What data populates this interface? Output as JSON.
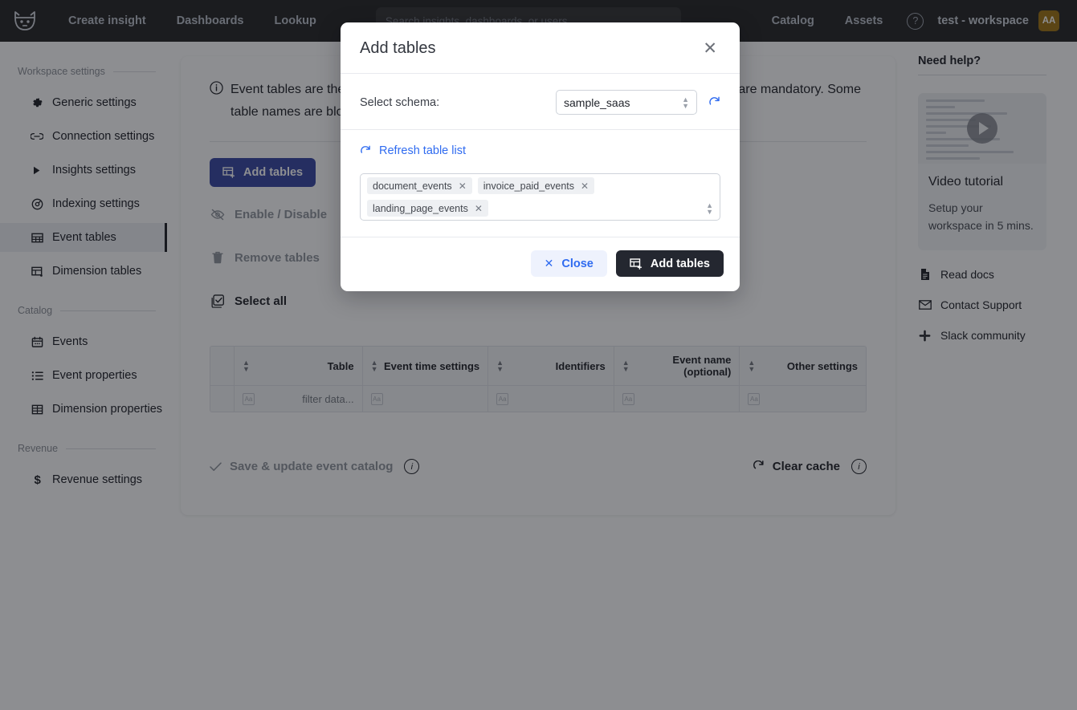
{
  "topnav": {
    "logo_icon": "cat-logo-icon",
    "links": [
      "Create insight",
      "Dashboards",
      "Lookup",
      "Catalog",
      "Assets"
    ],
    "search_placeholder": "Search insights, dashboards, or users",
    "search_value": "",
    "help_icon": "question-mark-icon",
    "workspace": "test - workspace",
    "avatar_initials": "AA"
  },
  "sidebar": {
    "groups": [
      {
        "title": "Workspace settings",
        "items": [
          {
            "label": "Generic settings",
            "icon": "gear-icon",
            "active": false
          },
          {
            "label": "Connection settings",
            "icon": "link-icon",
            "active": false
          },
          {
            "label": "Insights settings",
            "icon": "triangle-right-icon",
            "active": false
          },
          {
            "label": "Indexing settings",
            "icon": "compass-icon",
            "active": false
          },
          {
            "label": "Event tables",
            "icon": "table-icon",
            "active": true
          },
          {
            "label": "Dimension tables",
            "icon": "dimension-table-icon",
            "active": false
          }
        ]
      },
      {
        "title": "Catalog",
        "items": [
          {
            "label": "Events",
            "icon": "calendar-icon",
            "active": false
          },
          {
            "label": "Event properties",
            "icon": "list-icon",
            "active": false
          },
          {
            "label": "Dimension properties",
            "icon": "grid-icon",
            "active": false
          }
        ]
      },
      {
        "title": "Revenue",
        "items": [
          {
            "label": "Revenue settings",
            "icon": "dollar-icon",
            "active": false
          }
        ]
      }
    ]
  },
  "main": {
    "info_icon": "info-circle-icon",
    "info_text": "Event tables are the tables that contain your event data. User ID and event time columns are mandatory. Some table names are blocked and reserved for data warehouse tables that",
    "toolbar": {
      "add_tables_label": "Add tables",
      "add_tables_icon": "table-plus-icon",
      "enable_disable_label": "Enable / Disable",
      "enable_disable_icon": "eye-off-icon",
      "remove_tables_label": "Remove tables",
      "remove_tables_icon": "trash-icon",
      "select_all_label": "Select all",
      "select_all_icon": "checkbox-checked-icon"
    },
    "table": {
      "headers": [
        "Table",
        "Event time settings",
        "Identifiers",
        "Event name (optional)",
        "Other settings"
      ],
      "filter_placeholders": [
        "filter data...",
        "",
        "",
        "",
        ""
      ],
      "filter_icon": "text-filter-icon",
      "sort_icon": "sort-arrows-icon",
      "rows": []
    },
    "footer": {
      "save_label": "Save & update event catalog",
      "save_icon": "check-icon",
      "save_info_icon": "info-circle-icon",
      "clear_cache_label": "Clear cache",
      "clear_cache_icon": "refresh-ccw-icon",
      "clear_cache_info_icon": "info-circle-icon"
    }
  },
  "help_panel": {
    "title": "Need help?",
    "video": {
      "play_icon": "play-icon",
      "title": "Video tutorial",
      "description": "Setup your workspace in 5 mins."
    },
    "links": [
      {
        "label": "Read docs",
        "icon": "document-icon"
      },
      {
        "label": "Contact Support",
        "icon": "envelope-icon"
      },
      {
        "label": "Slack community",
        "icon": "slack-icon"
      }
    ]
  },
  "modal": {
    "title": "Add tables",
    "close_icon": "close-icon",
    "schema_label": "Select schema:",
    "schema_value": "sample_saas",
    "schema_chevron_icon": "chevron-updown-icon",
    "schema_refresh_icon": "refresh-icon",
    "refresh_link_label": "Refresh table list",
    "refresh_link_icon": "refresh-icon",
    "selected_tables": [
      "document_events",
      "invoice_paid_events",
      "landing_page_events"
    ],
    "chip_remove_icon": "close-small-icon",
    "multiselect_chevron_icon": "chevron-updown-icon",
    "close_button_label": "Close",
    "close_button_icon": "close-small-icon",
    "submit_button_label": "Add tables",
    "submit_button_icon": "table-plus-icon"
  },
  "colors": {
    "nav_bg": "#1b1b1b",
    "accent_blue": "#2f6bf0",
    "primary_button": "#2f3e9e",
    "dark_button": "#242730",
    "avatar_bg": "#9a6c06"
  }
}
